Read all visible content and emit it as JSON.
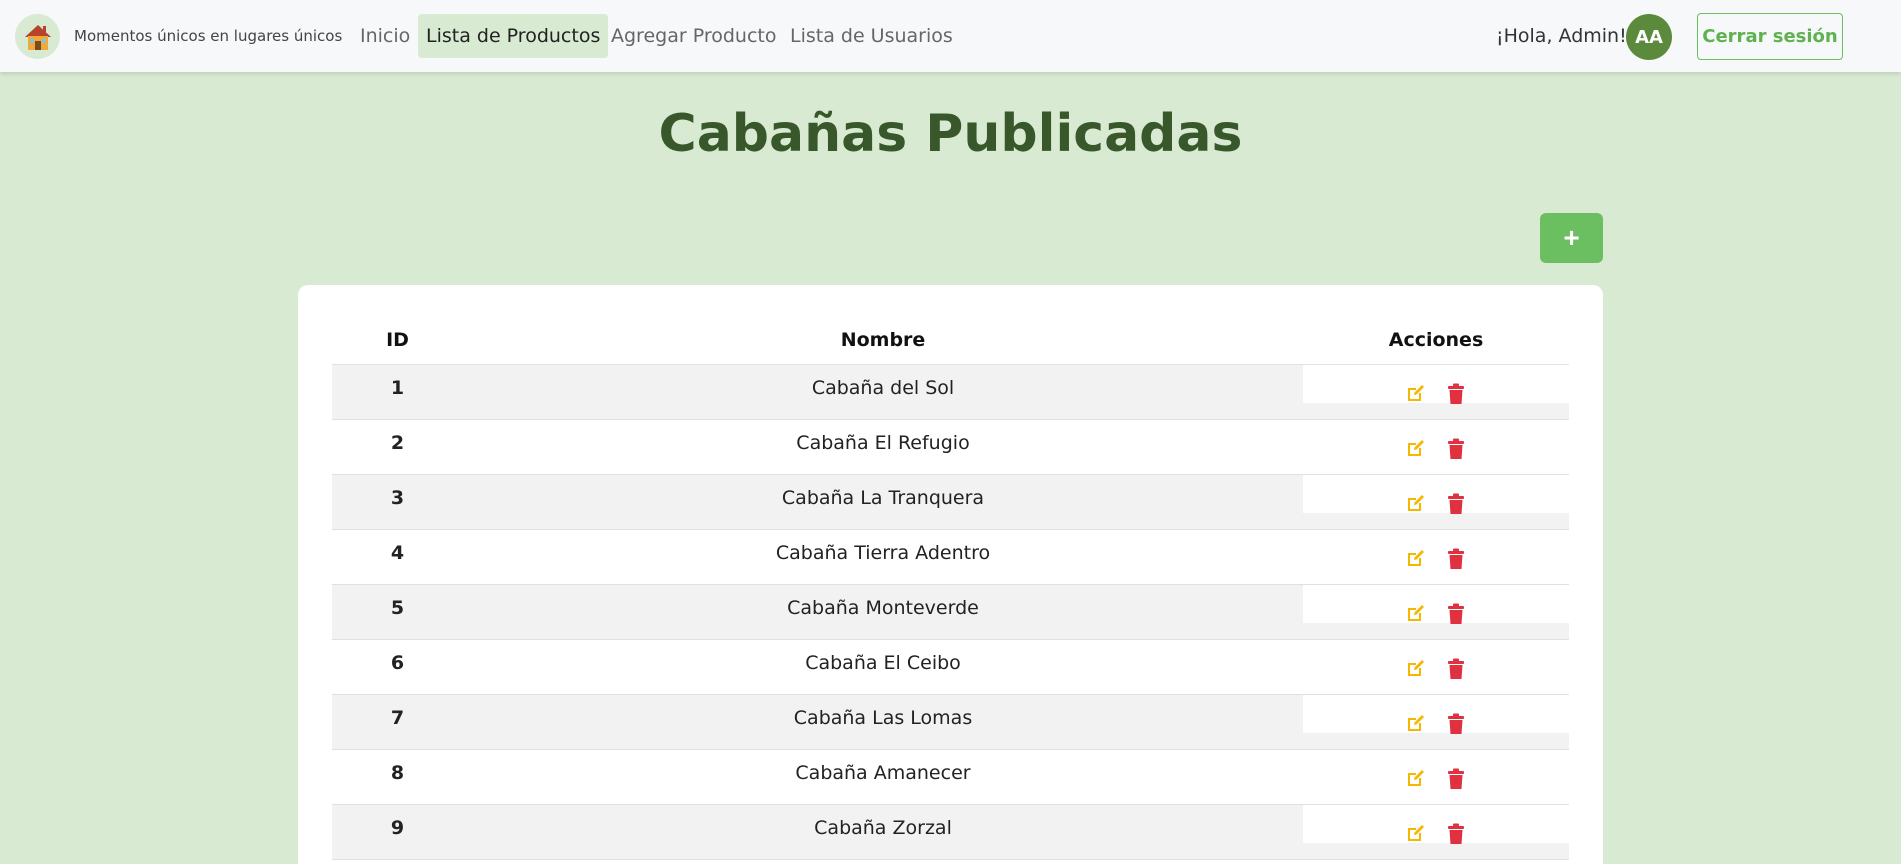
{
  "nav": {
    "tagline": "Momentos únicos en lugares únicos",
    "links": [
      {
        "label": "Inicio"
      },
      {
        "label": "Lista de Productos"
      },
      {
        "label": "Agregar Producto"
      },
      {
        "label": "Lista de Usuarios"
      }
    ],
    "active_index": 1,
    "greeting": "¡Hola, Admin!",
    "avatar_initials": "AA",
    "logout_label": "Cerrar sesión"
  },
  "page": {
    "title": "Cabañas Publicadas",
    "add_label": "+"
  },
  "table": {
    "headers": {
      "id": "ID",
      "name": "Nombre",
      "actions": "Acciones"
    },
    "rows": [
      {
        "id": "1",
        "name": "Cabaña del Sol"
      },
      {
        "id": "2",
        "name": "Cabaña El Refugio"
      },
      {
        "id": "3",
        "name": "Cabaña La Tranquera"
      },
      {
        "id": "4",
        "name": "Cabaña Tierra Adentro"
      },
      {
        "id": "5",
        "name": "Cabaña Monteverde"
      },
      {
        "id": "6",
        "name": "Cabaña El Ceibo"
      },
      {
        "id": "7",
        "name": "Cabaña Las Lomas"
      },
      {
        "id": "8",
        "name": "Cabaña Amanecer"
      },
      {
        "id": "9",
        "name": "Cabaña Zorzal"
      }
    ]
  },
  "icons": {
    "logo": "house-icon",
    "edit": "edit-icon",
    "delete": "trash-icon"
  },
  "colors": {
    "background": "#d9ead3",
    "accent_green": "#6cbf60",
    "title_green": "#38572a",
    "avatar_green": "#5b8a3c",
    "edit_yellow": "#f5b800",
    "delete_red": "#e03141"
  }
}
